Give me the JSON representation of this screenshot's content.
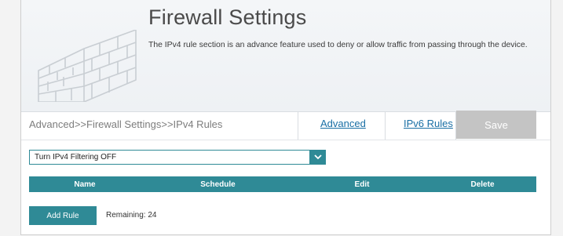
{
  "header": {
    "title": "Firewall Settings",
    "description": "The IPv4 rule section is an advance feature used to deny or allow traffic from passing through the device."
  },
  "toolbar": {
    "breadcrumb": "Advanced>>Firewall Settings>>IPv4 Rules",
    "advanced_link": "Advanced",
    "ipv6_link": "IPv6 Rules",
    "save_label": "Save"
  },
  "filter": {
    "selected": "Turn IPv4 Filtering OFF",
    "icon": "chevron-down-icon"
  },
  "table": {
    "columns": [
      "Name",
      "Schedule",
      "Edit",
      "Delete"
    ],
    "rows": []
  },
  "footer": {
    "add_rule_label": "Add Rule",
    "remaining_text": "Remaining: 24"
  },
  "colors": {
    "accent": "#2f8a96",
    "link": "#1a6fa5",
    "save_disabled": "#c4c4c4"
  },
  "icons": {
    "hero": "brick-wall-icon"
  }
}
